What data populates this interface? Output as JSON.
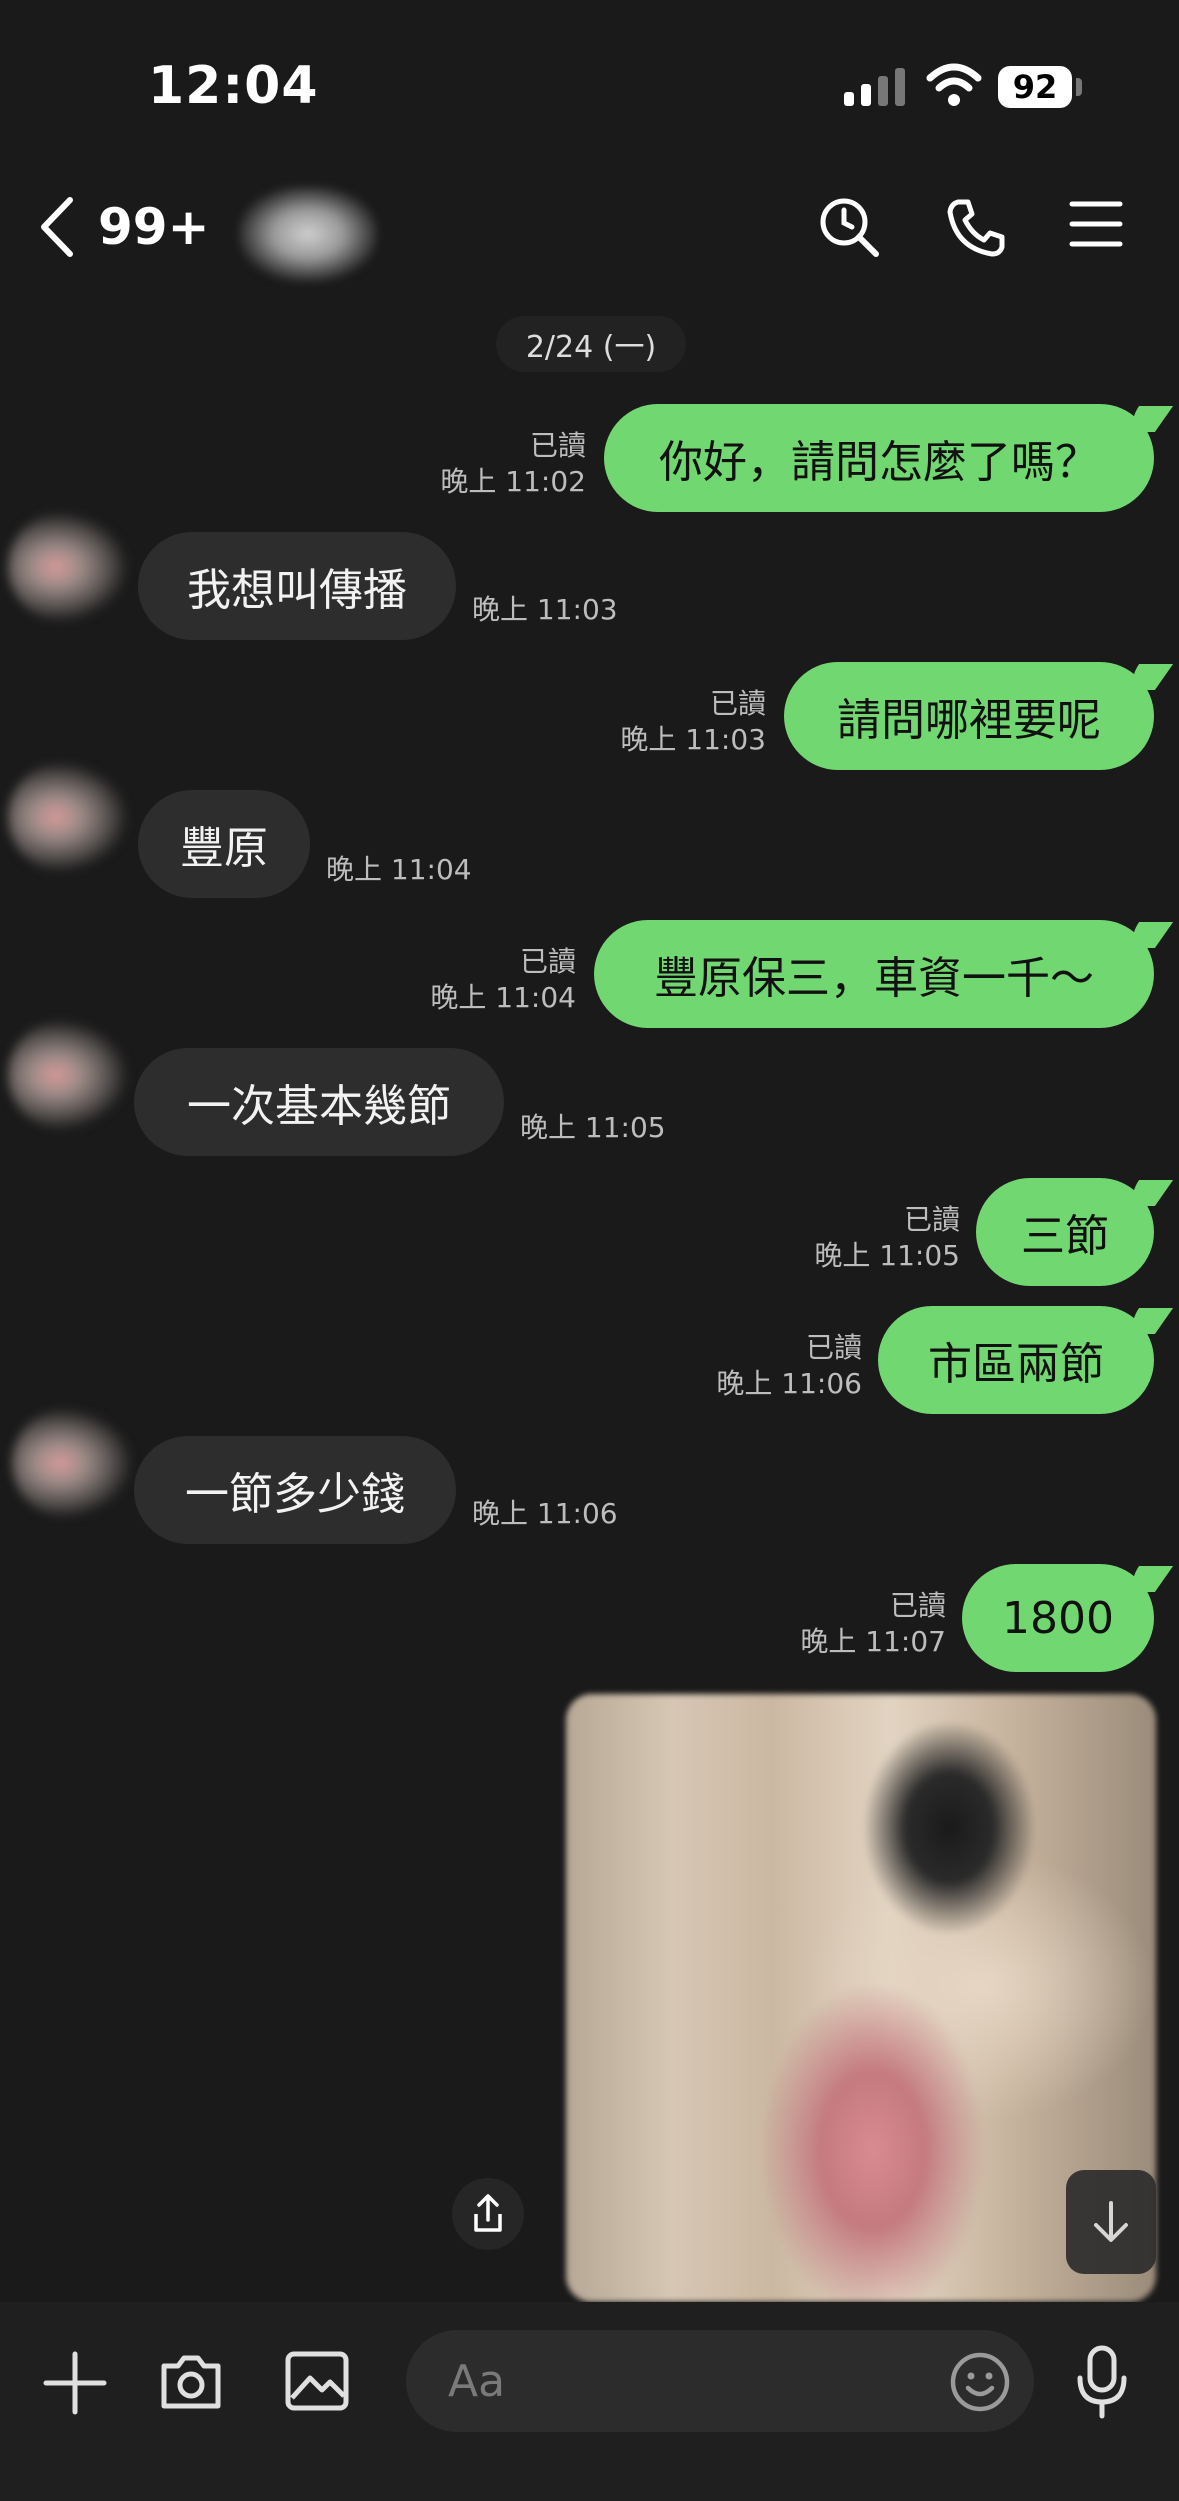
{
  "status_bar": {
    "time": "12:04",
    "battery": "92"
  },
  "header": {
    "unread_count": "99+"
  },
  "date_divider": "2/24 (一)",
  "messages": [
    {
      "side": "sent",
      "text": "你好，請問怎麼了嗎？",
      "read": "已讀",
      "time": "晚上 11:02"
    },
    {
      "side": "received",
      "text": "我想叫傳播",
      "time": "晚上 11:03"
    },
    {
      "side": "sent",
      "text": "請問哪裡要呢",
      "read": "已讀",
      "time": "晚上 11:03"
    },
    {
      "side": "received",
      "text": "豐原",
      "time": "晚上 11:04"
    },
    {
      "side": "sent",
      "text": "豐原保三，車資一千～",
      "read": "已讀",
      "time": "晚上 11:04"
    },
    {
      "side": "received",
      "text": "一次基本幾節",
      "time": "晚上 11:05"
    },
    {
      "side": "sent",
      "text": "三節",
      "read": "已讀",
      "time": "晚上 11:05"
    },
    {
      "side": "sent",
      "text": "市區兩節",
      "read": "已讀",
      "time": "晚上 11:06"
    },
    {
      "side": "received",
      "text": "一節多少錢",
      "time": "晚上 11:06"
    },
    {
      "side": "sent",
      "text": "1800",
      "read": "已讀",
      "time": "晚上 11:07"
    }
  ],
  "composer": {
    "placeholder": "Aa"
  }
}
